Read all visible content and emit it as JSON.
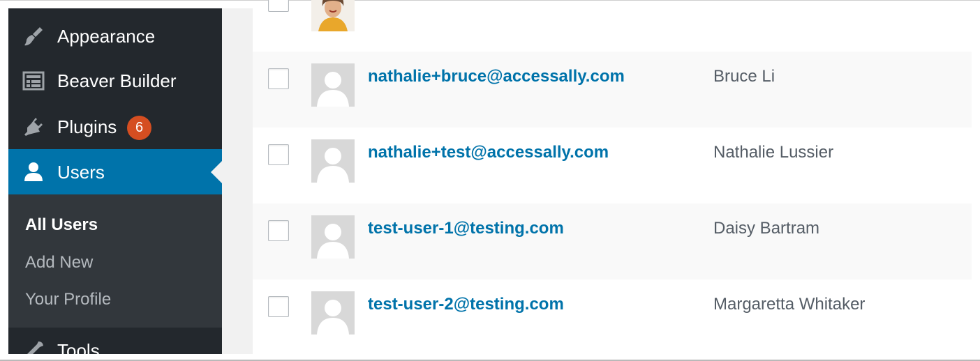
{
  "sidebar": {
    "menu": [
      {
        "label": "Appearance",
        "icon": "paintbrush-icon"
      },
      {
        "label": "Beaver Builder",
        "icon": "layout-grid-icon"
      },
      {
        "label": "Plugins",
        "icon": "plugin-icon",
        "badge": "6"
      },
      {
        "label": "Users",
        "icon": "user-icon",
        "active": true
      },
      {
        "label": "Tools",
        "icon": "wrench-icon"
      }
    ],
    "submenu": [
      {
        "label": "All Users",
        "current": true
      },
      {
        "label": "Add New"
      },
      {
        "label": "Your Profile"
      }
    ]
  },
  "users": [
    {
      "email": "nathalie+bruce@accessally.com",
      "name": "Bruce Li"
    },
    {
      "email": "nathalie+test@accessally.com",
      "name": "Nathalie Lussier"
    },
    {
      "email": "test-user-1@testing.com",
      "name": "Daisy Bartram"
    },
    {
      "email": "test-user-2@testing.com",
      "name": "Margaretta Whitaker"
    }
  ],
  "colors": {
    "sidebar_bg": "#23282d",
    "submenu_bg": "#32373c",
    "active_bg": "#0073aa",
    "link": "#0073aa",
    "badge": "#d54e21"
  }
}
